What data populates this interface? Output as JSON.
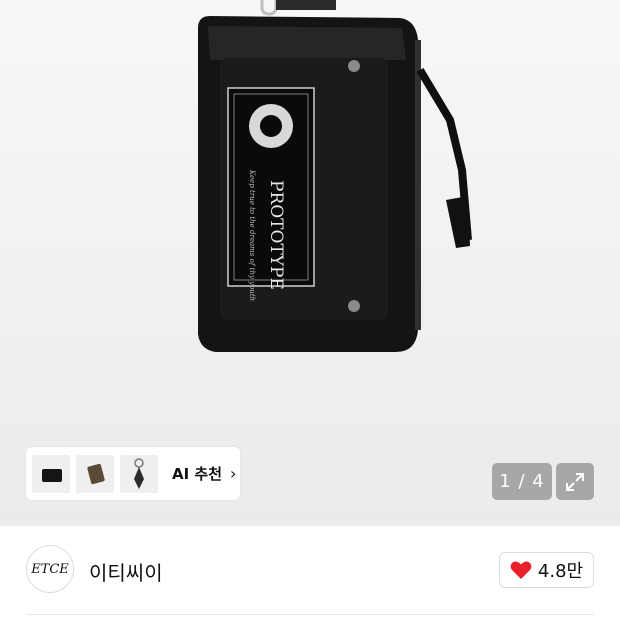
{
  "gallery": {
    "product_label_main": "PROTOTYPE",
    "product_label_sub": "Keep true to the dreams of thy youth",
    "ai_recommend_label": "AI 추천",
    "ai_recommend_chevron": "›",
    "counter": "1 / 4",
    "expand_icon": "expand-icon",
    "thumbnails": [
      {
        "icon": "wallet-thumbnail"
      },
      {
        "icon": "leather-case-thumbnail"
      },
      {
        "icon": "keyring-thumbnail"
      }
    ]
  },
  "brand": {
    "logo_text": "ETCE",
    "name": "이티씨이",
    "like_count": "4.8만",
    "heart_color": "#e8202a"
  }
}
